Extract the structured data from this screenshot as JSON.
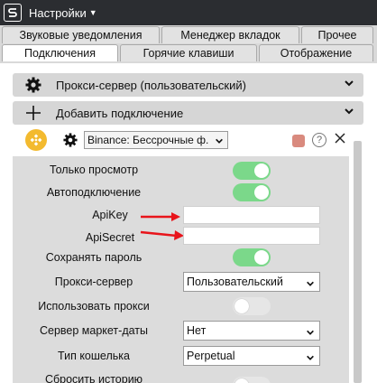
{
  "window": {
    "title": "Настройки"
  },
  "tabs": {
    "row1": [
      "Звуковые уведомления",
      "Менеджер вкладок",
      "Прочее"
    ],
    "row2": [
      "Подключения",
      "Горячие клавиши",
      "Отображение"
    ],
    "active": "Подключения"
  },
  "proxy_bar": {
    "label": "Прокси-сервер (пользовательский)"
  },
  "add_bar": {
    "label": "Добавить подключение"
  },
  "connection": {
    "selected": "Binance: Бессрочные ф.",
    "help": "?"
  },
  "form": {
    "view_only": {
      "label": "Только просмотр",
      "on": true
    },
    "autoconnect": {
      "label": "Автоподключение",
      "on": true
    },
    "apikey": {
      "label": "ApiKey",
      "value": ""
    },
    "apisecret": {
      "label": "ApiSecret",
      "value": ""
    },
    "save_password": {
      "label": "Сохранять пароль",
      "on": true
    },
    "proxy_server": {
      "label": "Прокси-сервер",
      "value": "Пользовательский"
    },
    "use_proxy": {
      "label": "Использовать прокси",
      "on": false
    },
    "market_server": {
      "label": "Сервер маркет-даты",
      "value": "Нет"
    },
    "wallet_type": {
      "label": "Тип кошелька",
      "value": "Perpetual"
    },
    "reset_history": {
      "label": "Сбросить историю"
    }
  },
  "colors": {
    "toggle_on": "#7bd88a",
    "annotation_arrow": "#e8141b",
    "binance": "#f3ba2f"
  }
}
